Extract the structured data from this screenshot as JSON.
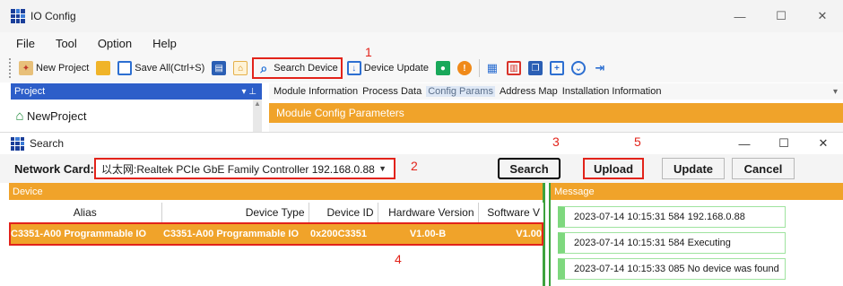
{
  "window": {
    "title": "IO Config",
    "minimize": "—",
    "maximize": "☐",
    "close": "✕"
  },
  "menu": [
    "File",
    "Tool",
    "Option",
    "Help"
  ],
  "toolbar": {
    "new_project": "New Project",
    "save_all": "Save All(Ctrl+S)",
    "search_device": "Search Device",
    "device_update": "Device Update"
  },
  "project_panel": {
    "header": "Project",
    "pin": "▾ ⊥",
    "tree_root": "NewProject"
  },
  "tabs": [
    "Module Information",
    "Process Data",
    "Config Params",
    "Address Map",
    "Installation Information"
  ],
  "active_tab": "Config Params",
  "module_bar": "Module Config Parameters",
  "dialog": {
    "title": "Search",
    "minimize": "—",
    "maximize": "☐",
    "close": "✕",
    "network_card_label": "Network Card:",
    "network_card_value": "以太网:Realtek PCIe GbE Family Controller 192.168.0.88",
    "search": "Search",
    "upload": "Upload",
    "update": "Update",
    "cancel": "Cancel",
    "device_header": "Device",
    "message_header": "Message"
  },
  "device_table": {
    "columns": [
      "Alias",
      "Device Type",
      "Device ID",
      "Hardware Version",
      "Software V"
    ],
    "rows": [
      [
        "C3351-A00 Programmable IO",
        "C3351-A00 Programmable IO",
        "0x200C3351",
        "V1.00-B",
        "V1.00"
      ]
    ]
  },
  "messages": [
    "2023-07-14 10:15:31 584  192.168.0.88",
    "2023-07-14 10:15:31 584  Executing",
    "2023-07-14 10:15:33 085  No device was found"
  ],
  "annotations": [
    "1",
    "2",
    "3",
    "4",
    "5"
  ],
  "colors": {
    "accent_orange": "#f0a32a",
    "highlight_red": "#e2231a",
    "panel_blue": "#2d5ec9",
    "message_green": "#7ed87e"
  }
}
